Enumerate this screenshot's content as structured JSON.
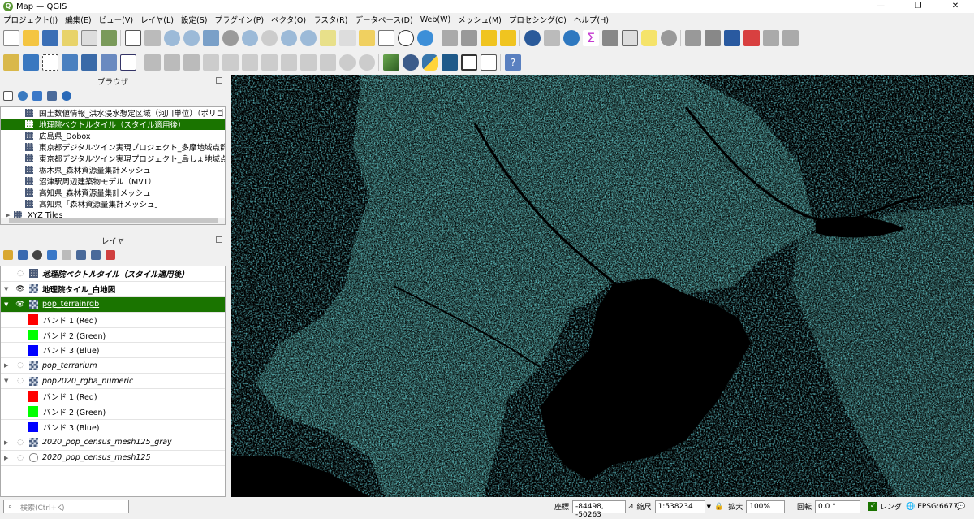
{
  "window": {
    "title": "Map — QGIS"
  },
  "menu": [
    "プロジェクト(J)",
    "編集(E)",
    "ビュー(V)",
    "レイヤ(L)",
    "設定(S)",
    "プラグイン(P)",
    "ベクタ(O)",
    "ラスタ(R)",
    "データベース(D)",
    "Web(W)",
    "メッシュ(M)",
    "プロセシング(C)",
    "ヘルプ(H)"
  ],
  "browser_panel": {
    "title": "ブラウザ",
    "items": [
      {
        "label": "国土数値情報_洪水浸水想定区域（河川単位）（ポリゴ"
      },
      {
        "label": "地理院ベクトルタイル（スタイル適用後）"
      },
      {
        "label": "広島県_Dobox"
      },
      {
        "label": "東京都デジタルツイン実現プロジェクト_多摩地域点群データ"
      },
      {
        "label": "東京都デジタルツイン実現プロジェクト_島しょ地域点群データ"
      },
      {
        "label": "栃木県_森林資源量集計メッシュ"
      },
      {
        "label": "沼津駅周辺建築物モデル（MVT）"
      },
      {
        "label": "高知県_森林資源量集計メッシュ"
      },
      {
        "label": "高知県「森林資源量集計メッシュ」"
      },
      {
        "label": "XYZ Tiles"
      }
    ],
    "selected_index": 1
  },
  "layers_panel": {
    "title": "レイヤ",
    "items": [
      {
        "label": "地理院ベクトルタイル（スタイル適用後）"
      },
      {
        "label": "地理院タイル_白地図"
      },
      {
        "label": "pop_terrainrgb"
      },
      {
        "label": "バンド 1 (Red)",
        "color": "#ff0000"
      },
      {
        "label": "バンド 2 (Green)",
        "color": "#00ff00"
      },
      {
        "label": "バンド 3 (Blue)",
        "color": "#0000ff"
      },
      {
        "label": "pop_terrarium"
      },
      {
        "label": "pop2020_rgba_numeric"
      },
      {
        "label": "バンド 1 (Red)",
        "color": "#ff0000"
      },
      {
        "label": "バンド 2 (Green)",
        "color": "#00ff00"
      },
      {
        "label": "バンド 3 (Blue)",
        "color": "#0000ff"
      },
      {
        "label": "2020_pop_census_mesh125_gray"
      },
      {
        "label": "2020_pop_census_mesh125"
      }
    ],
    "selected_index": 2
  },
  "map_canvas": {
    "background": "#000000",
    "feature_color": "#2aa59a"
  },
  "statusbar": {
    "locator_placeholder": "検索(Ctrl+K)",
    "coord_label": "座標",
    "coord_value": "-84498, -50263",
    "scale_label": "縮尺",
    "scale_value": "1:538234",
    "magnifier_label": "拡大",
    "magnifier_value": "100%",
    "rotation_label": "回転",
    "rotation_value": "0.0 °",
    "render_label": "レンダ",
    "crs": "EPSG:6677"
  }
}
